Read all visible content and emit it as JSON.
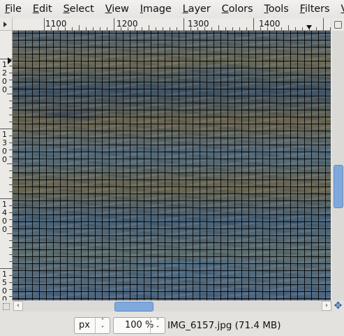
{
  "menubar": {
    "items": [
      {
        "label": "File",
        "mnemonic": "F",
        "rest": "ile"
      },
      {
        "label": "Edit",
        "mnemonic": "E",
        "rest": "dit"
      },
      {
        "label": "Select",
        "mnemonic": "S",
        "rest": "elect"
      },
      {
        "label": "View",
        "mnemonic": "V",
        "rest": "iew"
      },
      {
        "label": "Image",
        "mnemonic": "I",
        "rest": "mage"
      },
      {
        "label": "Layer",
        "mnemonic": "L",
        "rest": "ayer"
      },
      {
        "label": "Colors",
        "mnemonic": "C",
        "rest": "olors"
      },
      {
        "label": "Tools",
        "mnemonic": "T",
        "rest": "ools"
      },
      {
        "label": "Filters",
        "mnemonic": "F",
        "rest": "ilters"
      },
      {
        "label": "Video",
        "mnemonic": "V",
        "rest": "ideo"
      }
    ]
  },
  "rulers": {
    "horizontal_labels": [
      "1100",
      "1200",
      "1300",
      "1400"
    ],
    "vertical_labels": [
      [
        "1",
        "2",
        "0",
        "0"
      ],
      [
        "1",
        "3",
        "0",
        "0"
      ],
      [
        "1",
        "4",
        "0",
        "0"
      ],
      [
        "1",
        "5",
        "0",
        "0"
      ]
    ]
  },
  "scrollbars": {
    "horizontal_position": 0.32,
    "vertical_position": 0.5
  },
  "statusbar": {
    "unit": "px",
    "zoom": "100 %",
    "file_info": "IMG_6157.jpg (71.4 MB)"
  },
  "colors": {
    "scroll_thumb": "#7fa9db",
    "menubar_bg": "#eceae6"
  }
}
